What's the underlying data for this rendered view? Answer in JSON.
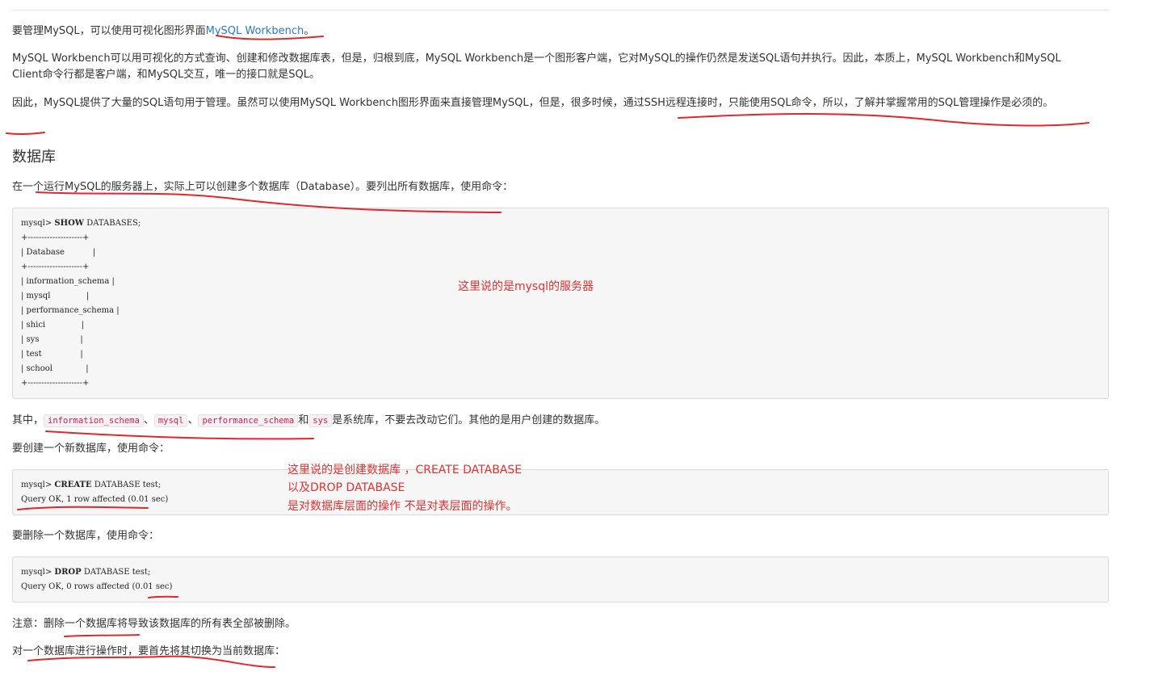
{
  "intro": {
    "p1_before": "要管理MySQL，可以使用可视化图形界面",
    "p1_link": "MySQL Workbench",
    "p1_after": "。",
    "p2": "MySQL Workbench可以用可视化的方式查询、创建和修改数据库表，但是，归根到底，MySQL Workbench是一个图形客户端，它对MySQL的操作仍然是发送SQL语句并执行。因此，本质上，MySQL Workbench和MySQL Client命令行都是客户端，和MySQL交互，唯一的接口就是SQL。",
    "p3": "因此，MySQL提供了大量的SQL语句用于管理。虽然可以使用MySQL Workbench图形界面来直接管理MySQL，但是，很多时候，通过SSH远程连接时，只能使用SQL命令，所以，了解并掌握常用的SQL管理操作是必须的。"
  },
  "section": {
    "title": "数据库",
    "p_list": "在一个运行MySQL的服务器上，实际上可以创建多个数据库（Database）。要列出所有数据库，使用命令：",
    "show_cmd": {
      "prompt": "mysql> ",
      "keyword": "SHOW",
      "rest": " DATABASES;",
      "output": [
        "+--------------------+",
        "| Database           |",
        "+--------------------+",
        "| information_schema |",
        "| mysql              |",
        "| performance_schema |",
        "| shici              |",
        "| sys                |",
        "| test               |",
        "| school             |",
        "+--------------------+"
      ]
    },
    "system_dbs": {
      "prefix": "其中，",
      "db1": "information_schema",
      "sep1": "、",
      "db2": "mysql",
      "sep2": "、",
      "db3": "performance_schema",
      "sep3": "和",
      "db4": "sys",
      "suffix": "是系统库，不要去改动它们。其他的是用户创建的数据库。"
    },
    "p_create": "要创建一个新数据库，使用命令：",
    "create_cmd": {
      "prompt": "mysql> ",
      "keyword": "CREATE",
      "rest": " DATABASE test;",
      "result": "Query OK, 1 row affected (0.01 sec)"
    },
    "p_drop": "要删除一个数据库，使用命令：",
    "drop_cmd": {
      "prompt": "mysql> ",
      "keyword": "DROP",
      "rest": " DATABASE test;",
      "result": "Query OK, 0 rows affected (0.01 sec)"
    },
    "p_note": "注意：删除一个数据库将导致该数据库的所有表全部被删除。",
    "p_switch": "对一个数据库进行操作时，要首先将其切换为当前数据库："
  },
  "annotations": {
    "server_note": "这里说的是mysql的服务器",
    "create_note_1": "这里说的是创建数据库 ，CREATE DATABASE",
    "create_note_2": "以及DROP DATABASE",
    "create_note_3": "是对数据库层面的操作  不是对表层面的操作。"
  },
  "colors": {
    "link": "#2a78c6",
    "annotation": "#e33131",
    "inline_code": "#c7254e"
  }
}
